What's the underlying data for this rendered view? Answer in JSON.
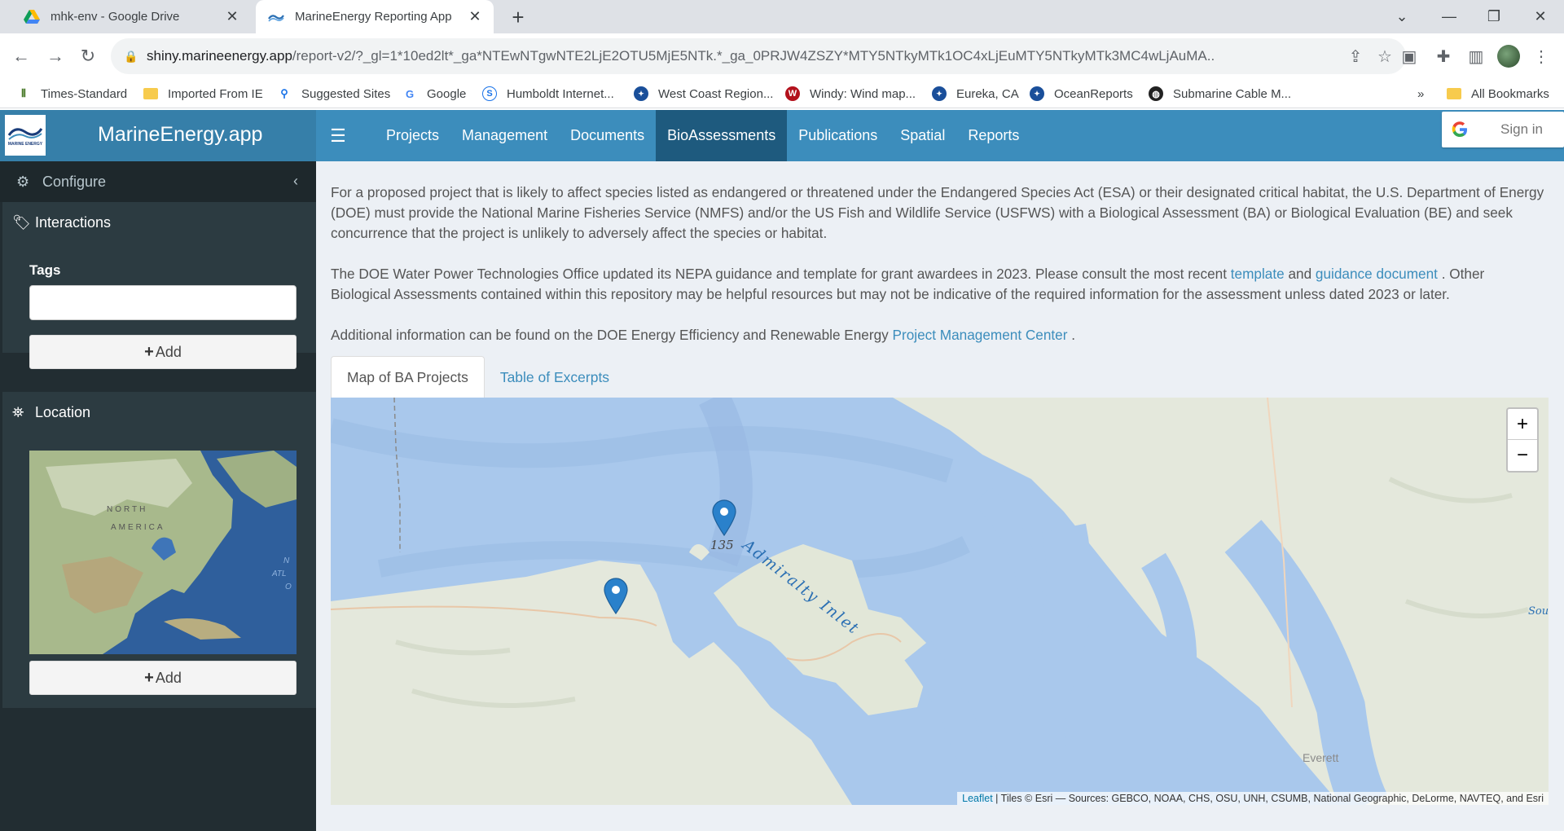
{
  "browser": {
    "tabs": [
      {
        "title": "mhk-env - Google Drive",
        "icon": "google-drive-icon",
        "active": false
      },
      {
        "title": "MarineEnergy Reporting App",
        "icon": "marine-energy-favicon",
        "active": true
      }
    ],
    "url_host": "shiny.marineenergy.app",
    "url_rest": "/report-v2/?_gl=1*10ed2lt*_ga*NTEwNTgwNTE2LjE2OTU5MjE5NTk.*_ga_0PRJW4ZSZY*MTY5NTkyMTk1OC4xLjEuMTY5NTkyMTk3MC4wLjAuMA..",
    "bookmarks": [
      {
        "label": "Times-Standard",
        "icon": "times-standard-icon"
      },
      {
        "label": "Imported From IE",
        "icon": "folder-icon"
      },
      {
        "label": "Suggested Sites",
        "icon": "search-icon"
      },
      {
        "label": "Google",
        "icon": "google-icon"
      },
      {
        "label": "Humboldt Internet...",
        "icon": "humboldt-icon"
      },
      {
        "label": "West Coast Region...",
        "icon": "noaa-icon"
      },
      {
        "label": "Windy: Wind map...",
        "icon": "windy-icon"
      },
      {
        "label": "Eureka, CA",
        "icon": "noaa-icon"
      },
      {
        "label": "OceanReports",
        "icon": "noaa-icon"
      },
      {
        "label": "Submarine Cable M...",
        "icon": "globe-icon"
      }
    ],
    "overflow": "»",
    "all_bookmarks": "All Bookmarks"
  },
  "app": {
    "brand_title": "MarineEnergy.app",
    "logo_text": "MARINE ENERGY",
    "nav": [
      "Projects",
      "Management",
      "Documents",
      "BioAssessments",
      "Publications",
      "Spatial",
      "Reports"
    ],
    "active_nav": "BioAssessments",
    "signin_label": "Sign in"
  },
  "sidebar": {
    "configure_label": "Configure",
    "interactions_label": "Interactions",
    "tags_label": "Tags",
    "tags_value": "",
    "add_label": "Add",
    "location_label": "Location",
    "mini_map": {
      "north": "NORTH",
      "america": "AMERICA",
      "atl_1": "N",
      "atl_2": "ATL",
      "atl_3": "O"
    }
  },
  "main": {
    "para1": "For a proposed project that is likely to affect species listed as endangered or threatened under the Endangered Species Act (ESA) or their designated critical habitat, the U.S. Department of Energy (DOE) must provide the National Marine Fisheries Service (NMFS) and/or the US Fish and Wildlife Service (USFWS) with a Biological Assessment (BA) or Biological Evaluation (BE) and seek concurrence that the project is unlikely to adversely affect the species or habitat.",
    "para2_a": "The DOE Water Power Technologies Office updated its NEPA guidance and template for grant awardees in 2023. Please consult the most recent ",
    "para2_link1": "template",
    "para2_b": " and ",
    "para2_link2": "guidance document",
    "para2_c": " . Other Biological Assessments contained within this repository may be helpful resources but may not be indicative of the required information for the assessment unless dated 2023 or later.",
    "para3_a": "Additional information can be found on the DOE Energy Efficiency and Renewable Energy ",
    "para3_link": "Project Management Center",
    "para3_b": " .",
    "tabs": [
      "Map of BA Projects",
      "Table of Excerpts"
    ],
    "selected_tab": "Map of BA Projects",
    "map": {
      "water_label": "Admiralty Inlet",
      "marker_label": "135",
      "place_everett": "Everett",
      "edge_label": "Sou",
      "zoom_in": "+",
      "zoom_out": "−",
      "attrib_link": "Leaflet",
      "attrib_text": " | Tiles © Esri — Sources: GEBCO, NOAA, CHS, OSU, UNH, CSUMB, National Geographic, DeLorme, NAVTEQ, and Esri",
      "water_color": "#a9c8ec",
      "land_color": "#e4e8dc",
      "marker_color": "#2a81cb"
    }
  }
}
